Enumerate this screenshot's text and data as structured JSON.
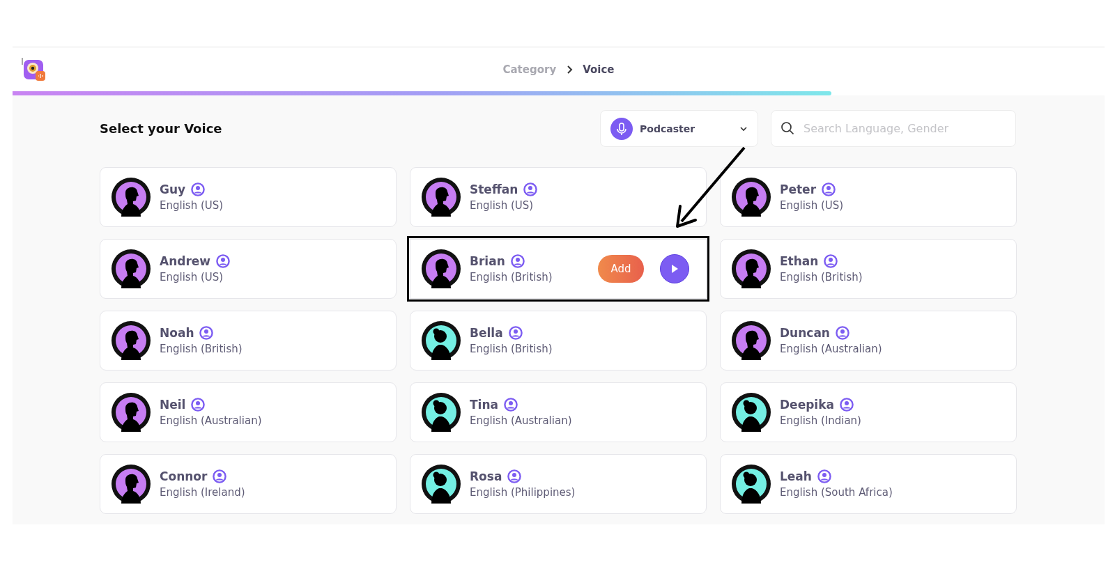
{
  "breadcrumb": [
    {
      "label": "Category",
      "selected": false
    },
    {
      "label": "Voice",
      "selected": true
    }
  ],
  "progress": {
    "level": 0.75
  },
  "page_title": "Select your Voice",
  "category_dropdown": {
    "value": "Podcaster"
  },
  "search": {
    "placeholder": "Search Language, Gender"
  },
  "voices": [
    {
      "name": "Guy",
      "language": "English (US)",
      "kind": "male",
      "highlighted": false
    },
    {
      "name": "Steffan",
      "language": "English (US)",
      "kind": "male",
      "highlighted": false
    },
    {
      "name": "Peter",
      "language": "English (US)",
      "kind": "male",
      "highlighted": false
    },
    {
      "name": "Andrew",
      "language": "English (US)",
      "kind": "male",
      "highlighted": false
    },
    {
      "name": "Brian",
      "language": "English (British)",
      "kind": "male",
      "highlighted": true,
      "add_label": "Add"
    },
    {
      "name": "Ethan",
      "language": "English (British)",
      "kind": "male",
      "highlighted": false
    },
    {
      "name": "Noah",
      "language": "English (British)",
      "kind": "male",
      "highlighted": false
    },
    {
      "name": "Bella",
      "language": "English (British)",
      "kind": "female",
      "highlighted": false
    },
    {
      "name": "Duncan",
      "language": "English (Australian)",
      "kind": "male",
      "highlighted": false
    },
    {
      "name": "Neil",
      "language": "English (Australian)",
      "kind": "male",
      "highlighted": false
    },
    {
      "name": "Tina",
      "language": "English (Australian)",
      "kind": "female",
      "highlighted": false
    },
    {
      "name": "Deepika",
      "language": "English (Indian)",
      "kind": "female",
      "highlighted": false
    },
    {
      "name": "Connor",
      "language": "English (Ireland)",
      "kind": "male",
      "highlighted": false
    },
    {
      "name": "Rosa",
      "language": "English (Philippines)",
      "kind": "female",
      "highlighted": false
    },
    {
      "name": "Leah",
      "language": "English (South Africa)",
      "kind": "female",
      "highlighted": false
    }
  ]
}
